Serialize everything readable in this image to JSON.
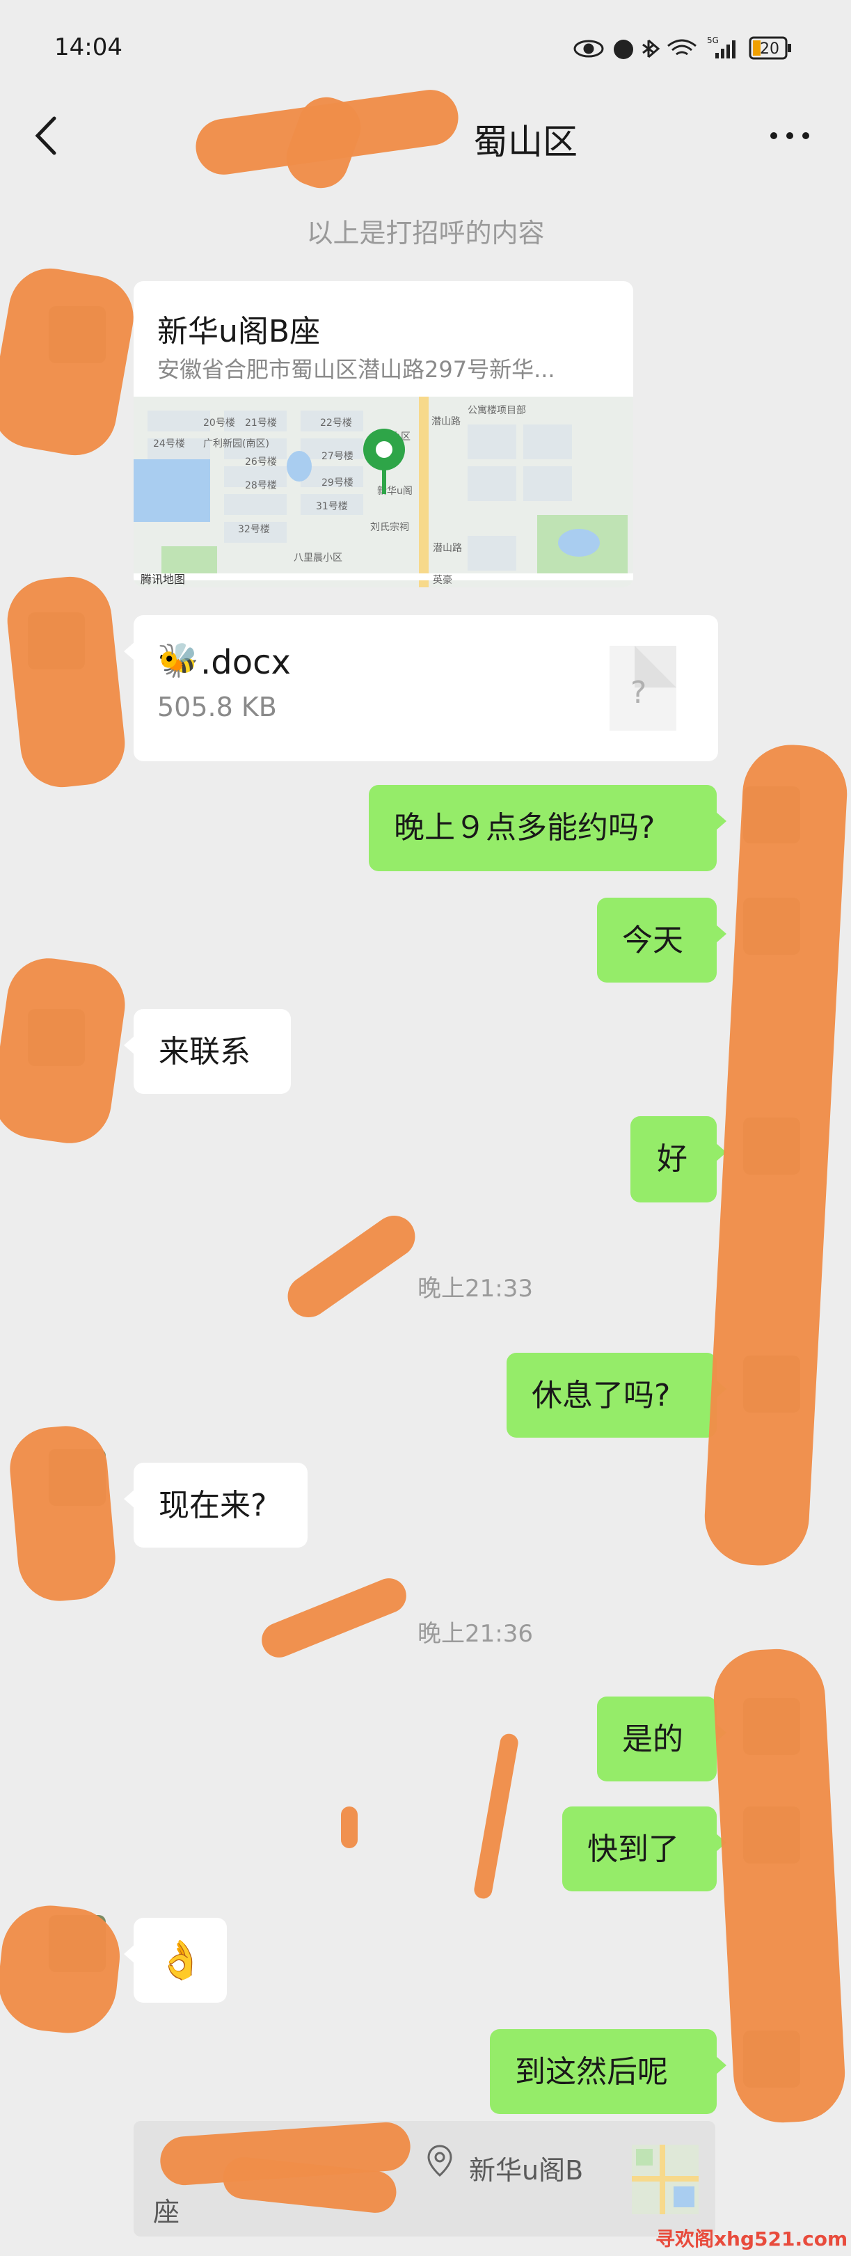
{
  "status_bar": {
    "time": "14:04",
    "network": "5G",
    "battery": "20"
  },
  "header": {
    "title_visible": "蜀山区"
  },
  "system_note": "以上是打招呼的内容",
  "location_card": {
    "title": "新华u阁B座",
    "address": "安徽省合肥市蜀山区潜山路297号新华...",
    "map_provider": "腾讯地图",
    "map_labels": [
      "公寓楼项目部",
      "20号楼",
      "21号楼",
      "22号楼",
      "潜山路",
      "24号楼",
      "广利新园(南区)",
      "26号楼",
      "27号楼",
      "28号楼",
      "29号楼",
      "31号楼",
      "32号楼",
      "八里晨小区",
      "刘氏宗祠",
      "英豪",
      "新华u阁",
      "小区",
      "潜山路"
    ]
  },
  "file_card": {
    "name": ".docx",
    "size": "505.8 KB",
    "icon_glyph": "?"
  },
  "messages": {
    "m1": "晚上９点多能约吗?",
    "m2": "今天",
    "m3": "来联系",
    "m4": "好",
    "t1": "晚上21:33",
    "m5": "休息了吗?",
    "m6": "现在来?",
    "t2": "晚上21:36",
    "m7": "是的",
    "m8": "快到了",
    "m9": "👌",
    "m10": "到这然后呢"
  },
  "reply_preview": {
    "text_line1": "新华u阁B",
    "text_line2": "座"
  },
  "watermark": "寻欢阁xhg521.com",
  "colors": {
    "background": "#ededed",
    "bubble_green": "#95ec69",
    "bubble_white": "#ffffff",
    "redaction": "#ef8d49"
  }
}
